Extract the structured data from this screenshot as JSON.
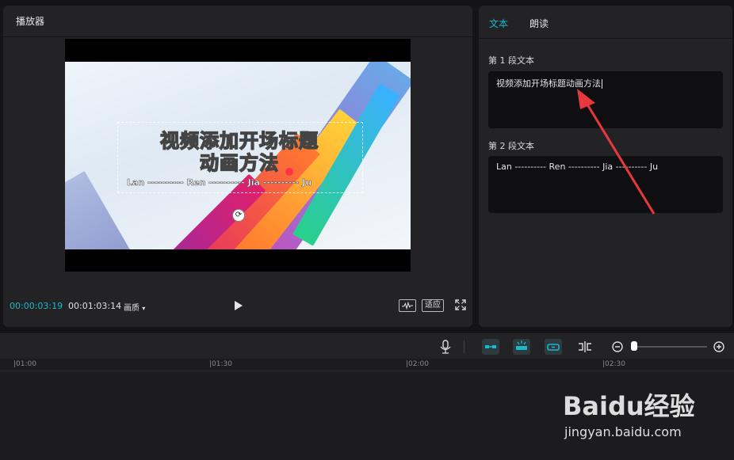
{
  "player": {
    "title": "播放器",
    "video": {
      "title_line1": "视频添加开场标题",
      "title_line2": "动画方法",
      "subtitle": "Lan ---------- Ren ---------- Jia ---------- Ju"
    },
    "current_time": "00:00:03:19",
    "total_time": "00:01:03:14",
    "quality_label": "画质",
    "fit_label": "适应"
  },
  "text_panel": {
    "tabs": [
      {
        "label": "文本",
        "active": true
      },
      {
        "label": "朗读",
        "active": false
      }
    ],
    "sections": [
      {
        "label": "第 1 段文本",
        "value": "视频添加开场标题动画方法"
      },
      {
        "label": "第 2 段文本",
        "value": "Lan ---------- Ren ---------- Jia ---------- Ju"
      }
    ]
  },
  "timeline": {
    "ruler_labels": [
      "|01:00",
      "|01:30",
      "|02:00",
      "|02:30"
    ]
  },
  "watermark": {
    "brand": "Baidu经验",
    "url": "jingyan.baidu.com"
  },
  "colors": {
    "accent": "#1bb8c8",
    "annotation_arrow": "#e8383d"
  }
}
